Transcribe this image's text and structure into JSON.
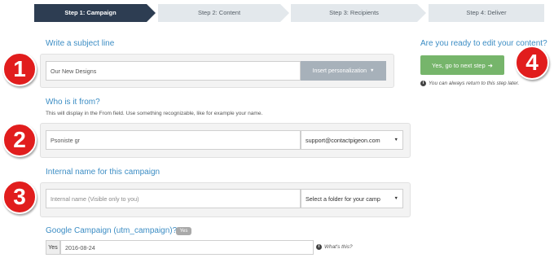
{
  "steps": [
    {
      "label": "Step 1: Campaign",
      "active": true
    },
    {
      "label": "Step 2: Content",
      "active": false
    },
    {
      "label": "Step 3: Recipients",
      "active": false
    },
    {
      "label": "Step 4: Deliver",
      "active": false
    }
  ],
  "subject": {
    "title": "Write a subject line",
    "value": "Our New Designs",
    "personalize_label": "Insert personalization"
  },
  "from": {
    "title": "Who is it from?",
    "helper": "This will display in the From field. Use something recognizable, like for example your name.",
    "name_value": "Psoniste gr",
    "email_value": "support@contactpigeon.com"
  },
  "internal": {
    "title": "Internal name for this campaign",
    "name_placeholder": "Internal name (Visible only to you)",
    "folder_value": "Select a folder for your camp"
  },
  "google": {
    "title": "Google Campaign (utm_campaign)?",
    "badge": "Yes",
    "addon": "Yes",
    "value": "2016-08-24",
    "whats_this": "What's this?"
  },
  "ready": {
    "title": "Are you ready to edit your content?",
    "button_label": "Yes, go to next step",
    "hint": "You can always return to this step later."
  },
  "badges": [
    "1",
    "2",
    "3",
    "4"
  ],
  "colors": {
    "active_step": "#2d3d52",
    "inactive_step": "#e3e8ec",
    "title_blue": "#3c8dc4",
    "next_button": "#76b56b",
    "badge_red": "#e11d1d"
  }
}
